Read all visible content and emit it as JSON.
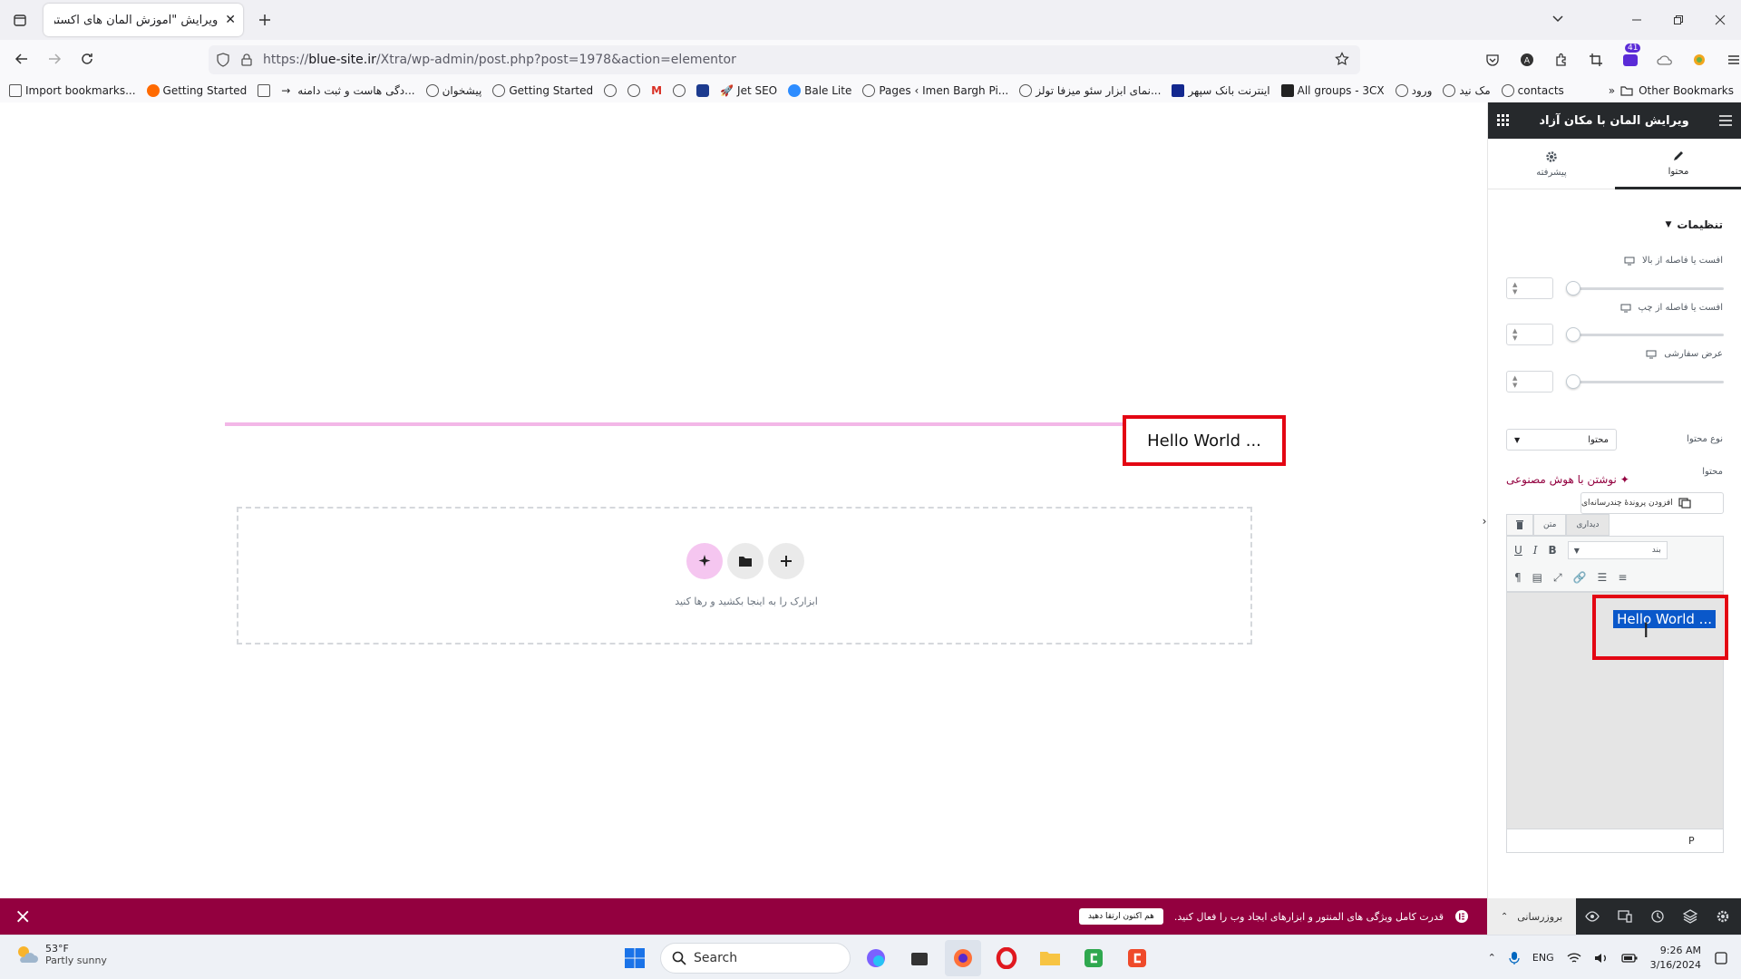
{
  "browser": {
    "tab_title": "ویرایش \"آموزش المان های اکسترا – ...",
    "url_prefix": "https://",
    "url_domain": "blue-site.ir",
    "url_path": "/Xtra/wp-admin/post.php?post=1978&action=elementor",
    "extensions_badge": "41",
    "bookmarks": [
      {
        "label": "Import bookmarks...",
        "icon": "import-icon"
      },
      {
        "label": "Getting Started",
        "icon": "firefox-icon"
      },
      {
        "label": "",
        "icon": "calendar-icon"
      },
      {
        "label": "...دگی هاست و ثبت دامنه",
        "icon": "arrow-icon"
      },
      {
        "label": "پیشخوان",
        "icon": "wordpress-icon"
      },
      {
        "label": "Getting Started",
        "icon": "globe-icon"
      },
      {
        "label": "",
        "icon": "globe-icon"
      },
      {
        "label": "",
        "icon": "globe-icon"
      },
      {
        "label": "",
        "icon": "gmail-icon"
      },
      {
        "label": "",
        "icon": "globe-icon"
      },
      {
        "label": "",
        "icon": "site-icon"
      },
      {
        "label": "Jet SEO",
        "icon": "rocket-icon"
      },
      {
        "label": "Bale Lite",
        "icon": "bale-icon"
      },
      {
        "label": "Pages ‹ Imen Bargh Pi...",
        "icon": "globe-icon"
      },
      {
        "label": "...نمای ابزار سئو میزفا تولز",
        "icon": "mizfa-icon"
      },
      {
        "label": "اینترنت بانک سپهر",
        "icon": "bank-icon"
      },
      {
        "label": "All groups - 3CX",
        "icon": "3cx-icon"
      },
      {
        "label": "ورود",
        "icon": "globe-icon"
      },
      {
        "label": "مک نید",
        "icon": "globe-icon"
      },
      {
        "label": "contacts",
        "icon": "globe-icon"
      }
    ],
    "other_bookmarks": "Other Bookmarks"
  },
  "canvas": {
    "heading_text": "Hello World ...",
    "drop_hint": "ابزارک را به اینجا بکشید و رها کنید"
  },
  "panel": {
    "title": "ویرایش المان با مکان آزاد",
    "tab_content": "محتوا",
    "tab_advanced": "پیشرفته",
    "section_title": "تنظیمات",
    "controls": [
      {
        "label": "افست یا فاصله از بالا"
      },
      {
        "label": "افست یا فاصله از چپ"
      },
      {
        "label": "عرض سفارشی"
      }
    ],
    "content_type_label": "نوع محتوا",
    "content_type_value": "محتوا",
    "content_label": "محتوا",
    "ai_link": "نوشتن با هوش مصنوعی",
    "add_media": "افزودن پروندهٔ چندرسانه‌ای",
    "editor_tab_visual": "دیداری",
    "editor_tab_text": "متن",
    "format_select": "بند",
    "editor_content": "Hello World ...",
    "editor_status": "P"
  },
  "promo": {
    "message": "قدرت کامل ویژگی های المنتور و ابزارهای ایجاد وب را فعال کنید.",
    "cta": "هم اکنون ارتقا دهید"
  },
  "footer": {
    "publish": "بروزرسانی"
  },
  "taskbar": {
    "temp": "53°F",
    "weather": "Partly sunny",
    "search_placeholder": "Search",
    "lang": "ENG",
    "time": "9:26 AM",
    "date": "3/16/2024"
  }
}
